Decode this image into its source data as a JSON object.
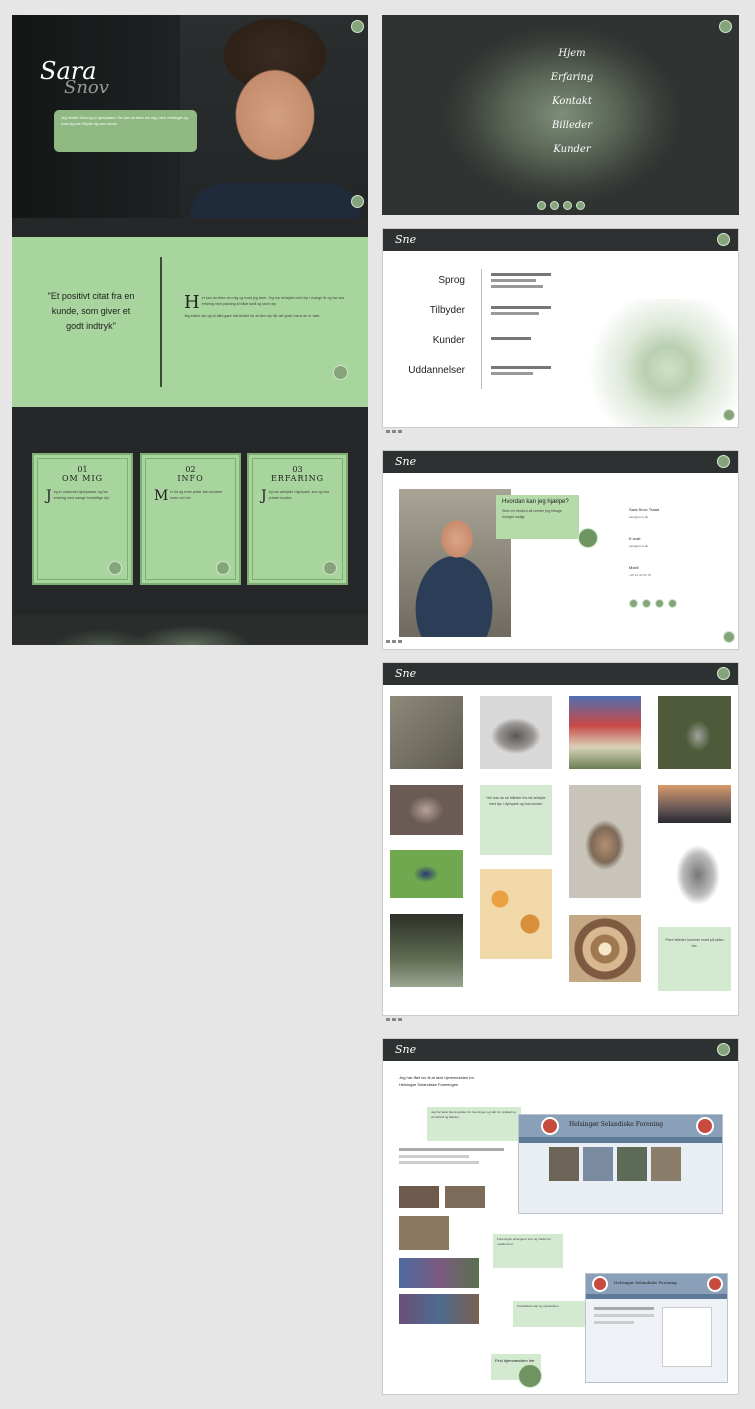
{
  "colors": {
    "green": "#a8d49d",
    "dark": "#252728",
    "accent": "#86a47c"
  },
  "brand": {
    "first": "Sara",
    "last": "Snov",
    "header_logo": "Sne"
  },
  "hero": {
    "intro": "Jeg hedder Sara og er dyrepasser. Her kan du læse om mig, mine erfaringer og hvad jeg kan tilbyde dig som kunde."
  },
  "quote": {
    "text": "\"Et positivt citat fra en kunde, som giver et godt indtryk\""
  },
  "about": {
    "drop": "H",
    "p1": "er kan du læse om mig og hvad jeg laver. Jeg har arbejdet med dyr i mange år og har stor erfaring med pasning af både små og store dyr.",
    "p2": "Jeg elsker dyr og vil altid gøre mit bedste for at dine dyr får det godt, mens du er væk."
  },
  "info_cards": [
    {
      "num": "01",
      "title": "OM MIG",
      "drop": "J",
      "text": "eg er uddannet dyrepasser og har erfaring med mange forskellige dyr."
    },
    {
      "num": "02",
      "title": "INFO",
      "drop": "M",
      "text": "in tid og mine priser kan du læse mere om her."
    },
    {
      "num": "03",
      "title": "ERFARING",
      "drop": "J",
      "text": "eg har arbejdet i dyrepark, zoo og hos private kunder."
    }
  ],
  "menu": {
    "items": [
      "Hjem",
      "Erfaring",
      "Kontakt",
      "Billeder",
      "Kunder"
    ]
  },
  "services": {
    "labels": [
      "Sprog",
      "Tilbyder",
      "Kunder",
      "Uddannelser"
    ]
  },
  "contact": {
    "question": "Hvordan kan jeg hjælpe?",
    "text": "Skriv en besked så vender jeg tilbage hurtigst muligt.",
    "fields": [
      "Sara Snov Traad",
      "E-mail",
      "Mobil"
    ],
    "values": [
      "sara@snov.dk",
      "sara@snov.dk",
      "+45 12 34 56 78"
    ]
  },
  "gallery": {
    "text_block1": "Her kan du se billeder fra mit arbejde med dyr i dyrepark og hos kunder.",
    "text_block2": "Flere billeder kommer snart på siden her."
  },
  "customers": {
    "title": "Jeg har fået lov til at lave hjemmesiden for",
    "subtitle": "Helsingør Selandiske Foreningen",
    "site_title": "Helsingør Selandiske Forening",
    "note1": "Jeg har lavet hjemmesiden for foreningen og står for opdatering af indhold og billeder.",
    "note2": "Foreningen arrangerer ture og møder for medlemmer.",
    "note3": "Kontaktformular og nyhedsbrev.",
    "cta": "Find hjemmesiden her"
  }
}
